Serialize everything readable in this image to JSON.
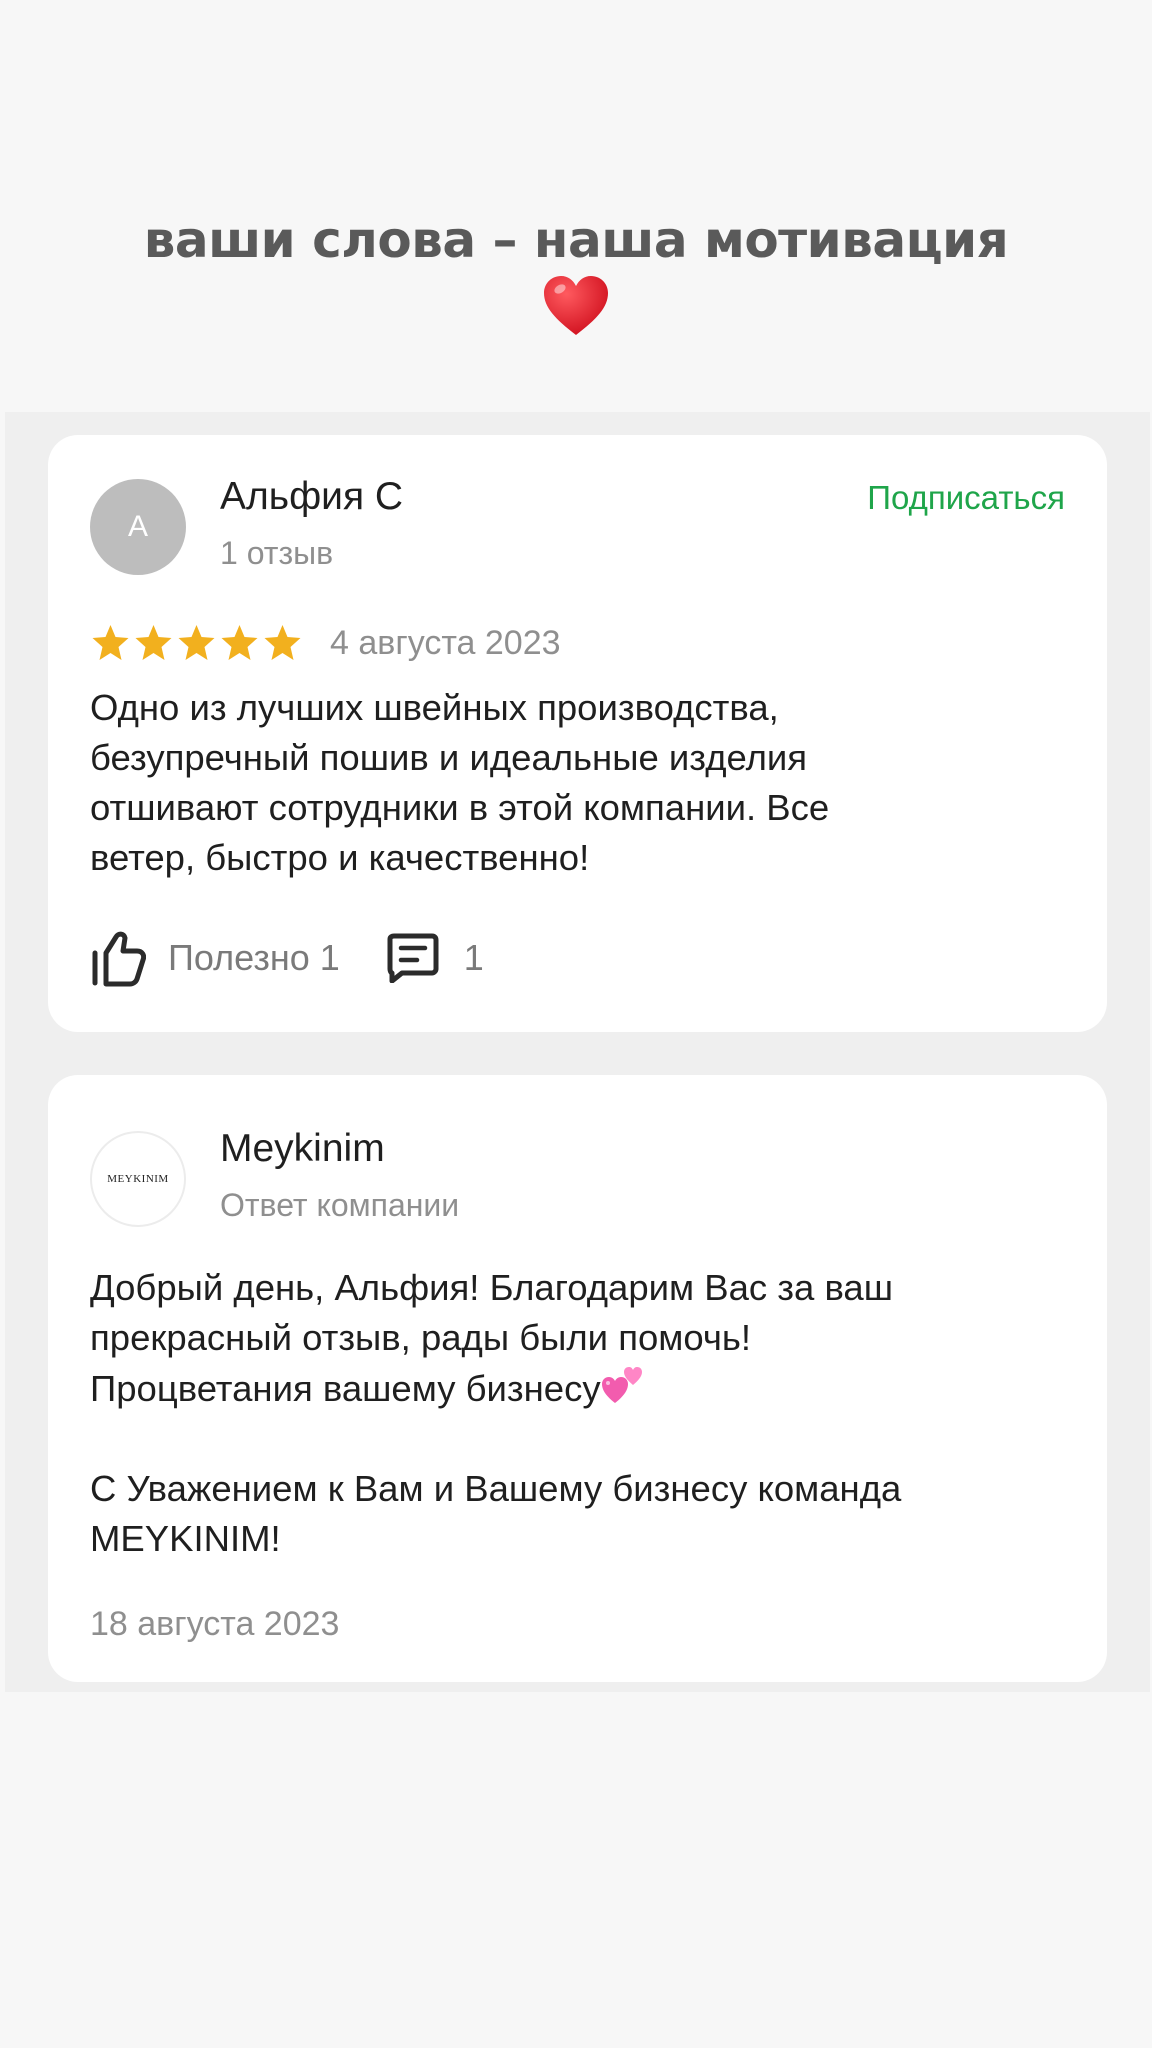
{
  "header": {
    "title": "ваши слова – наша мотивация",
    "emoji": "heart"
  },
  "review": {
    "avatar_letter": "А",
    "author": "Альфия С",
    "reviews_count": "1 отзыв",
    "subscribe_label": "Подписаться",
    "rating": 5,
    "rating_max": 5,
    "date": "4 августа 2023",
    "text": "Одно из лучших швейных производства,\nбезупречный пошив и идеальные изделия\nотшивают сотрудники в этой компании. Все\nветер, быстро и качественно!",
    "useful_label": "Полезно 1",
    "comments_count": "1"
  },
  "reply": {
    "logo_text": "MEYKINIM",
    "author": "Meykinim",
    "subtitle": "Ответ компании",
    "text_part1": "Добрый день, Альфия! Благодарим Вас за ваш\nпрекрасный отзыв, рады были помочь!\nПроцветания вашему бизнесу",
    "emoji": "two-hearts",
    "text_part2": "\n\nС Уважением к Вам и Вашему бизнесу команда\nMEYKINIM!",
    "date": "18 августа 2023"
  },
  "colors": {
    "accent_green": "#1fa54a",
    "star_gold": "#f2b01e",
    "heart_red": "#e0212b",
    "emoji_pink": "#f25cae"
  }
}
